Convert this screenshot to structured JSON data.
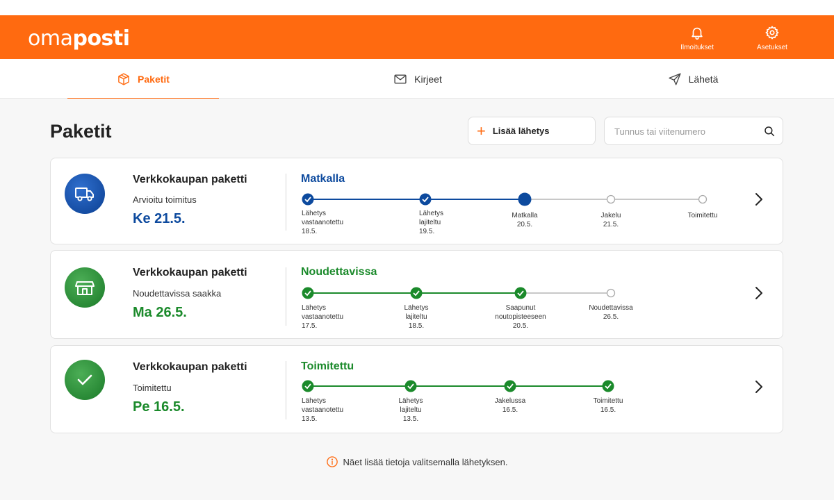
{
  "header": {
    "logo_regular": "oma",
    "logo_bold": "posti",
    "notifications_label": "Ilmoitukset",
    "settings_label": "Asetukset",
    "brand_color": "#ff6a10"
  },
  "tabs": [
    {
      "label": "Paketit",
      "icon": "package-icon",
      "active": true
    },
    {
      "label": "Kirjeet",
      "icon": "envelope-icon",
      "active": false
    },
    {
      "label": "Lähetä",
      "icon": "send-icon",
      "active": false
    }
  ],
  "main": {
    "title": "Paketit",
    "add_button_label": "Lisää lähetys",
    "search_placeholder": "Tunnus tai viitenumero",
    "footer_note": "Näet lisää tietoja valitsemalla lähetyksen."
  },
  "shipments": [
    {
      "name": "Verkkokaupan paketti",
      "sub": "Arvioitu toimitus",
      "date": "Ke 21.5.",
      "status": "Matkalla",
      "status_color": "#0d4a9e",
      "icon": "truck-icon",
      "steps": [
        {
          "l1": "Lähetys",
          "l2": "vastaanotettu",
          "d": "18.5."
        },
        {
          "l1": "Lähetys",
          "l2": "lajiteltu",
          "d": "19.5."
        },
        {
          "l1": "Matkalla",
          "l2": "",
          "d": "20.5."
        },
        {
          "l1": "Jakelu",
          "l2": "",
          "d": "21.5."
        },
        {
          "l1": "Toimitettu",
          "l2": "",
          "d": ""
        }
      ]
    },
    {
      "name": "Verkkokaupan paketti",
      "sub": "Noudettavissa saakka",
      "date": "Ma 26.5.",
      "status": "Noudettavissa",
      "status_color": "#1b8a2b",
      "icon": "store-icon",
      "steps": [
        {
          "l1": "Lähetys",
          "l2": "vastaanotettu",
          "d": "17.5."
        },
        {
          "l1": "Lähetys",
          "l2": "lajiteltu",
          "d": "18.5."
        },
        {
          "l1": "Saapunut",
          "l2": "noutopisteeseen",
          "d": "20.5."
        },
        {
          "l1": "Noudettavissa",
          "l2": "",
          "d": "26.5."
        }
      ]
    },
    {
      "name": "Verkkokaupan paketti",
      "sub": "Toimitettu",
      "date": "Pe 16.5.",
      "status": "Toimitettu",
      "status_color": "#1b8a2b",
      "icon": "check-icon",
      "steps": [
        {
          "l1": "Lähetys",
          "l2": "vastaanotettu",
          "d": "13.5."
        },
        {
          "l1": "Lähetys",
          "l2": "lajiteltu",
          "d": "13.5."
        },
        {
          "l1": "Jakelussa",
          "l2": "",
          "d": "16.5."
        },
        {
          "l1": "Toimitettu",
          "l2": "",
          "d": "16.5."
        }
      ]
    }
  ]
}
